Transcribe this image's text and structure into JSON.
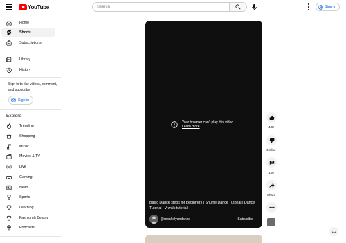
{
  "header": {
    "logo_text": "YouTube",
    "search_placeholder": "Search",
    "sign_in_label": "Sign in"
  },
  "sidebar": {
    "main_items": [
      {
        "label": "Home",
        "icon": "home-icon"
      },
      {
        "label": "Shorts",
        "icon": "shorts-icon",
        "active": true
      },
      {
        "label": "Subscriptions",
        "icon": "subscriptions-icon"
      }
    ],
    "library_items": [
      {
        "label": "Library",
        "icon": "library-icon"
      },
      {
        "label": "History",
        "icon": "history-icon"
      }
    ],
    "sign_in_prompt": "Sign in to like videos, comment, and subscribe.",
    "sign_in_label": "Sign in",
    "explore_title": "Explore",
    "explore_items": [
      {
        "label": "Trending",
        "icon": "trending-icon"
      },
      {
        "label": "Shopping",
        "icon": "shopping-icon"
      },
      {
        "label": "Music",
        "icon": "music-icon"
      },
      {
        "label": "Movies & TV",
        "icon": "movies-icon"
      },
      {
        "label": "Live",
        "icon": "live-icon"
      },
      {
        "label": "Gaming",
        "icon": "gaming-icon"
      },
      {
        "label": "News",
        "icon": "news-icon"
      },
      {
        "label": "Sports",
        "icon": "sports-icon"
      },
      {
        "label": "Learning",
        "icon": "learning-icon"
      },
      {
        "label": "Fashion & Beauty",
        "icon": "fashion-icon"
      },
      {
        "label": "Podcasts",
        "icon": "podcasts-icon"
      }
    ]
  },
  "player": {
    "error_message": "Your browser can't play this video.",
    "error_link": "Learn more",
    "video_title": "Basic Dance steps for beginners | Shuffle Dance Tutorial | Dance Tutorial | V walk tutorial",
    "channel_name": "@monkelyandance",
    "subscribe_label": "Subscribe"
  },
  "actions": {
    "like_count": "43K",
    "dislike_label": "Dislike",
    "comment_count": "106",
    "share_label": "Share"
  },
  "colors": {
    "brand_red": "#ff0000",
    "link_blue": "#065fd4",
    "player_bg": "#0f0f0f"
  }
}
